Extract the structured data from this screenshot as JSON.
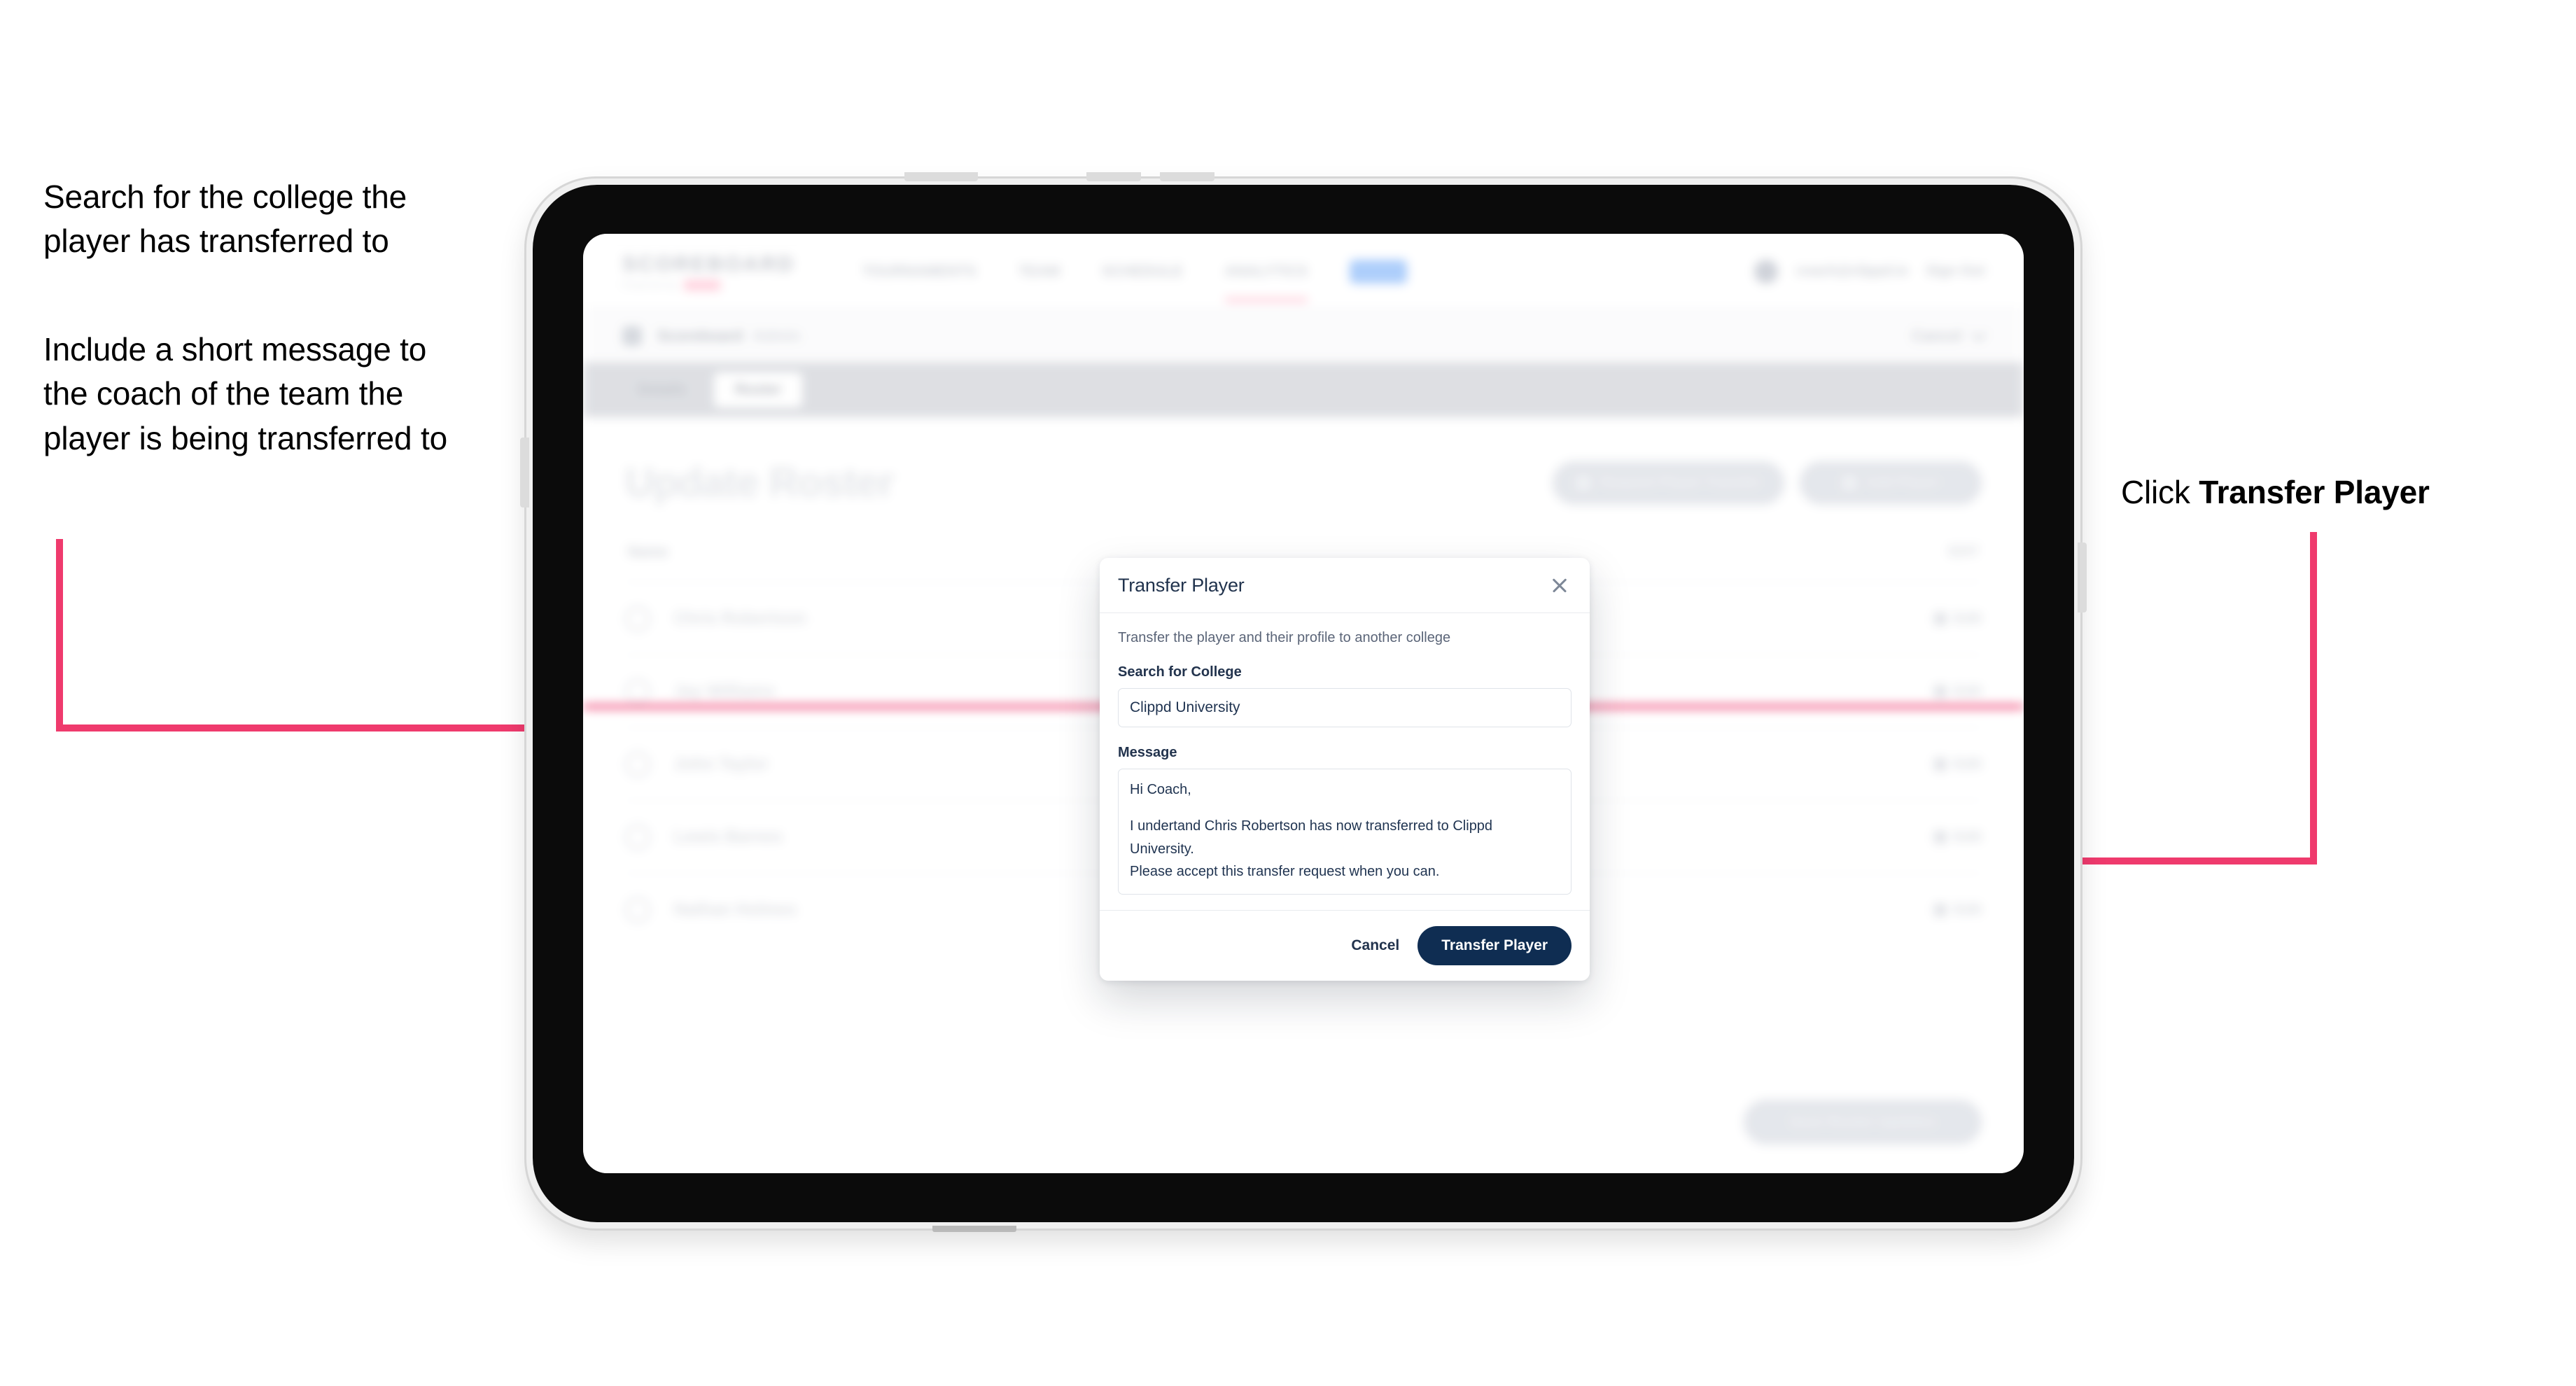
{
  "annotations": {
    "left_1": "Search for the college the player has transferred to",
    "left_2": "Include a short message to the coach of the team the player is being transferred to",
    "right_1_prefix": "Click ",
    "right_1_bold": "Transfer Player"
  },
  "app": {
    "logo": {
      "main": "SCOREBOARD",
      "sub": "Powered by",
      "badge": "clippd"
    },
    "nav_items": [
      {
        "label": "TOURNAMENTS",
        "active": false
      },
      {
        "label": "TEAM",
        "active": false
      },
      {
        "label": "SCHEDULE",
        "active": false
      },
      {
        "label": "ANALYTICS",
        "active": false
      }
    ],
    "nav_pill_label": "",
    "nav_right": {
      "user": "coach@clippd.io",
      "signout": "Sign Out"
    },
    "breadcrumb": {
      "root": "Scoreboard",
      "current": "Admin",
      "cancel": "Cancel"
    },
    "tabs": [
      {
        "label": "Details",
        "active": false
      },
      {
        "label": "Roster",
        "active": true
      }
    ],
    "page_title": "Update Roster",
    "header_actions": [
      "Request Player Transfer",
      "Add Player"
    ],
    "roster": {
      "column_header": "Name",
      "column_header_right": "EDIT",
      "rows": [
        {
          "name": "Chris Robertson",
          "action": "Edit"
        },
        {
          "name": "Jay Williams",
          "action": "Edit"
        },
        {
          "name": "John Taylor",
          "action": "Edit"
        },
        {
          "name": "Lewis Barnes",
          "action": "Edit"
        },
        {
          "name": "Nathan Holmes",
          "action": "Edit"
        }
      ]
    },
    "footer_button": "Save Roster Updates"
  },
  "modal": {
    "title": "Transfer Player",
    "subtitle": "Transfer the player and their profile to another college",
    "college_label": "Search for College",
    "college_value": "Clippd University",
    "college_placeholder": "Search for College",
    "message_label": "Message",
    "message_line_1": "Hi Coach,",
    "message_line_2": "I undertand Chris Robertson has now transferred to Clippd University.",
    "message_line_3": "Please accept this transfer request when you can.",
    "cancel_label": "Cancel",
    "submit_label": "Transfer Player"
  },
  "colors": {
    "annotation_arrow": "#ef3a6d",
    "primary_button": "#0f2d52",
    "brand_pink": "#ef3a6d"
  }
}
